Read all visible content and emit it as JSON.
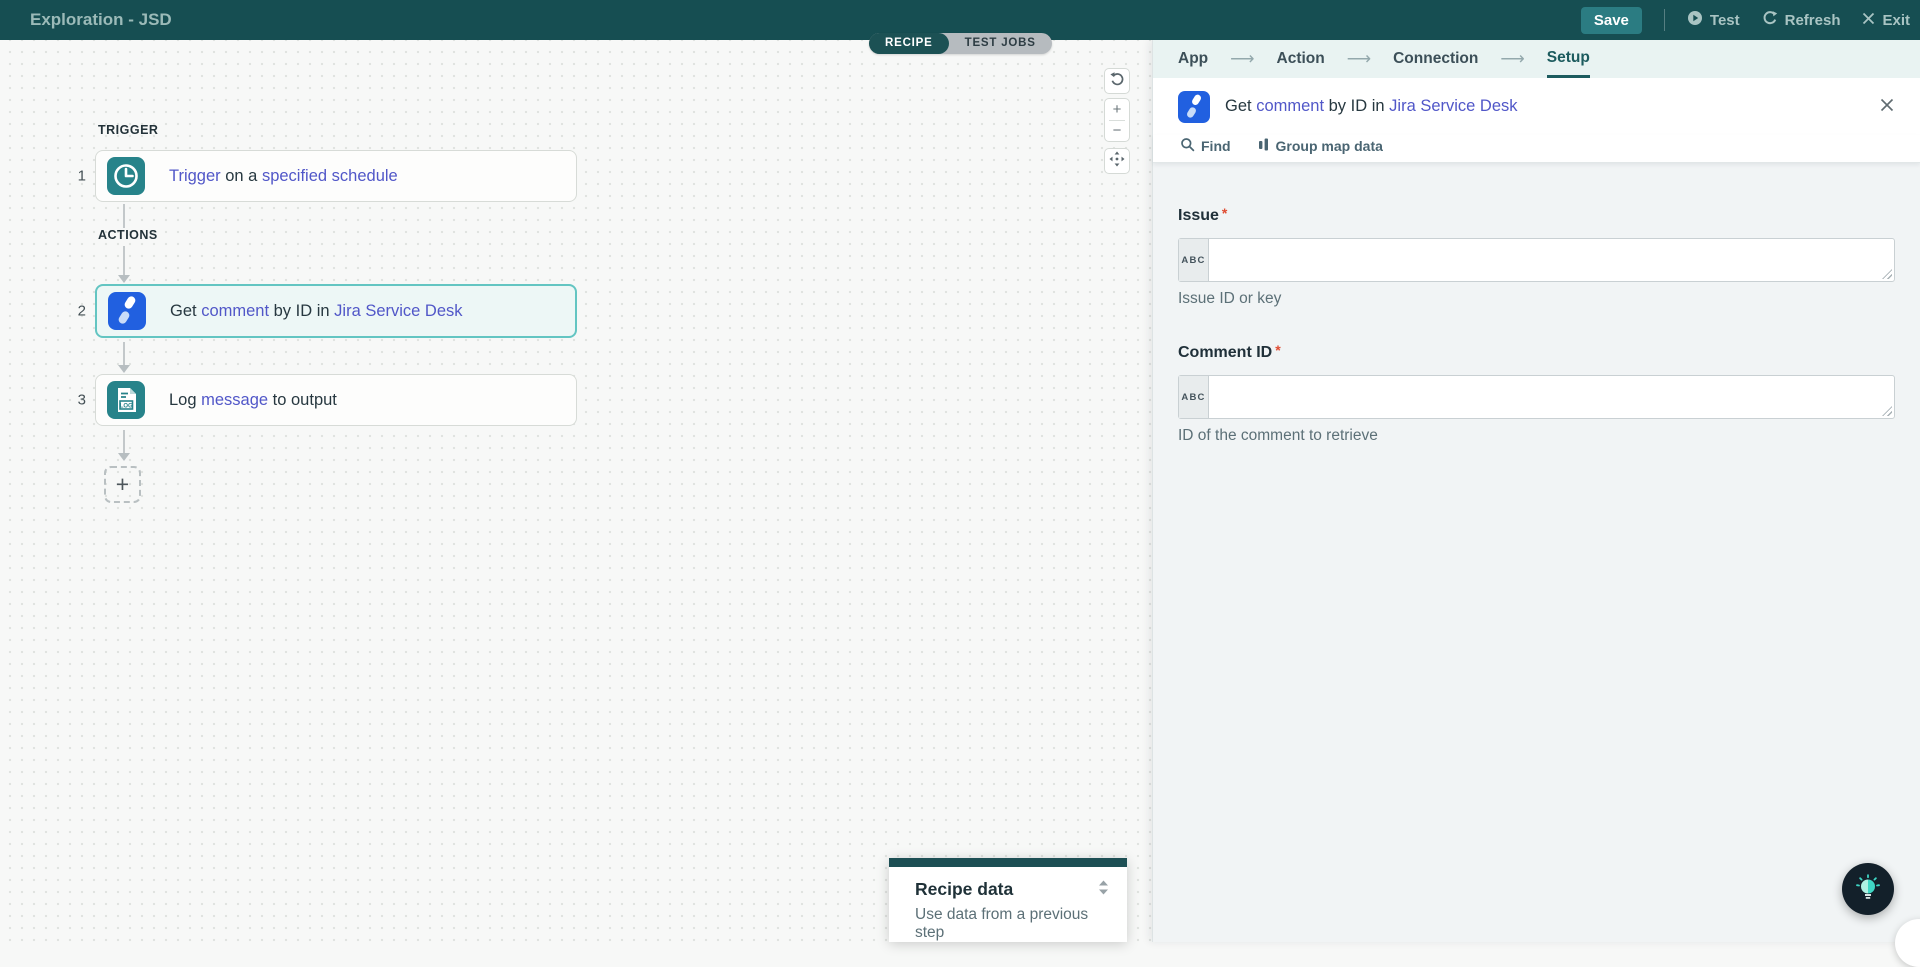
{
  "topbar": {
    "title": "Exploration - JSD",
    "save_label": "Save",
    "test_label": "Test",
    "refresh_label": "Refresh",
    "exit_label": "Exit"
  },
  "tabs": {
    "recipe": "RECIPE",
    "test_jobs": "TEST JOBS"
  },
  "canvas": {
    "trigger_section_label": "TRIGGER",
    "actions_section_label": "ACTIONS",
    "steps": [
      {
        "number": "1",
        "segments": [
          {
            "text": "Trigger",
            "link": true
          },
          {
            "text": " on a ",
            "link": false
          },
          {
            "text": "specified schedule",
            "link": true
          }
        ]
      },
      {
        "number": "2",
        "selected": true,
        "segments": [
          {
            "text": "Get ",
            "link": false
          },
          {
            "text": "comment",
            "link": true
          },
          {
            "text": " by ID in ",
            "link": false
          },
          {
            "text": "Jira Service Desk",
            "link": true
          }
        ]
      },
      {
        "number": "3",
        "segments": [
          {
            "text": "Log ",
            "link": false
          },
          {
            "text": "message",
            "link": true
          },
          {
            "text": " to output",
            "link": false
          }
        ]
      }
    ],
    "add_step_label": "+",
    "zoom_controls": {
      "zoom_in": "+",
      "zoom_out": "−"
    }
  },
  "panel": {
    "breadcrumbs": [
      {
        "label": "App"
      },
      {
        "label": "Action"
      },
      {
        "label": "Connection"
      },
      {
        "label": "Setup",
        "active": true
      }
    ],
    "crumb_arrow": "⟶",
    "header_segments": [
      {
        "text": "Get ",
        "link": false
      },
      {
        "text": "comment",
        "link": true
      },
      {
        "text": " by ID in ",
        "link": false
      },
      {
        "text": "Jira Service Desk",
        "link": true
      }
    ],
    "toolbar": {
      "find_label": "Find",
      "group_map_label": "Group map data"
    },
    "fields": [
      {
        "label": "Issue",
        "required_mark": "*",
        "addon": "ABC",
        "value": "",
        "helper": "Issue ID or key"
      },
      {
        "label": "Comment ID",
        "required_mark": "*",
        "addon": "ABC",
        "value": "",
        "helper": "ID of the comment to retrieve"
      }
    ]
  },
  "recipe_data_panel": {
    "title": "Recipe data",
    "subtitle": "Use data from a previous step"
  },
  "colors": {
    "topbar": "#164e52",
    "accent_teal": "#27838a",
    "selected_border": "#63c5c2",
    "link": "#5157c8",
    "jira_blue": "#2160e0",
    "required": "#df4b31"
  }
}
